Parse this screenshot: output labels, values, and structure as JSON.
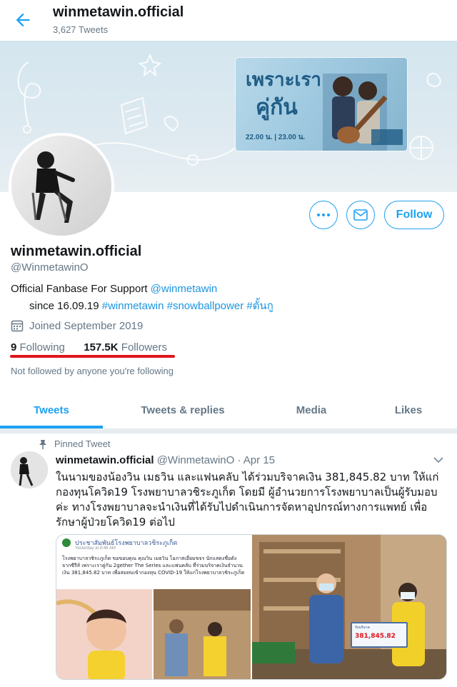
{
  "topbar": {
    "title": "winmetawin.official",
    "tweet_count": "3,627 Tweets"
  },
  "banner": {
    "poster_title_line1": "เพราะเรา",
    "poster_title_line2": "คู่กัน",
    "poster_times": "22.00 น. | 23.00 น."
  },
  "actions": {
    "follow_label": "Follow"
  },
  "profile": {
    "name": "winmetawin.official",
    "handle": "@WinmetawinO",
    "bio_line1_text": "Official Fanbase For Support ",
    "bio_line1_mention": "@winmetawin",
    "bio_line2_text": "since 16.09.19 ",
    "bio_hashtags": "#winmetawin #snowballpower #ตั้นกู",
    "joined": "Joined September 2019",
    "following_count": "9",
    "following_label": "Following",
    "followers_count": "157.5K",
    "followers_label": "Followers",
    "not_followed": "Not followed by anyone you're following"
  },
  "tabs": [
    {
      "label": "Tweets",
      "active": true
    },
    {
      "label": "Tweets & replies",
      "active": false
    },
    {
      "label": "Media",
      "active": false
    },
    {
      "label": "Likes",
      "active": false
    }
  ],
  "tweet": {
    "pinned_label": "Pinned Tweet",
    "author_name": "winmetawin.official",
    "author_handle": "@WinmetawinO",
    "date": "· Apr 15",
    "text": "ในนามของน้องวิน เมธวิน และแฟนคลับ ได้ร่วมบริจาคเงิน 381,845.82 บาท ให้แก่กองทุนโควิด19 โรงพยาบาลวชิระภูเก็ต โดยมี ผู้อำนวยการโรงพยาบาลเป็นผู้รับมอบค่ะ ทางโรงพยาบาลจะนำเงินที่ได้รับไปดำเนินการจัดหาอุปกรณ์ทางการแพทย์ เพื่อรักษาผู้ป่วยโควิด19 ต่อไป",
    "media": {
      "fb_page": "ประชาสัมพันธ์โรงพยาบาลวชิระภูเก็ต",
      "fb_time": "Yesterday at 8:46 AM",
      "fb_text": "โรงพยาบาลวชิระภูเก็ต ขอขอบคุณ คุณวิน เมธวิน โอภาสเอี่ยมขจร นักแสดงชื่อดังจากซีรีส์ เพราะเราคู่กัน 2gether The Series และแฟนคลับ ที่ร่วมบริจาคเงินจำนวนเงิน 381,845.82 บาท เพื่อสมทบเข้ากองทุน COVID-19 ให้แก่โรงพยาบาลวชิระภูเก็ต",
      "sign_title": "รับบริจาค",
      "sign_amount": "381,845.82"
    }
  },
  "colors": {
    "accent": "#1da1f2",
    "underline_mark": "#e0141d",
    "muted": "#657786"
  }
}
